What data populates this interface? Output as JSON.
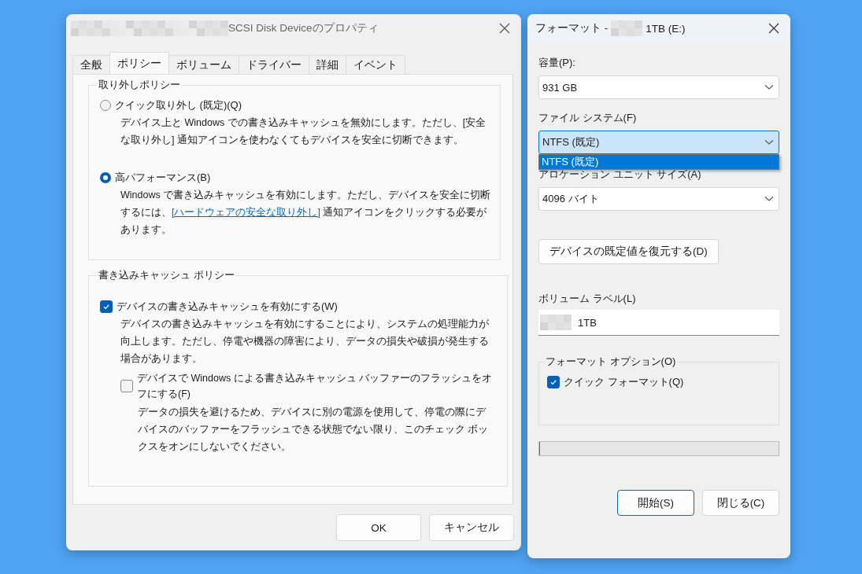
{
  "properties_window": {
    "title": "SCSI Disk Deviceのプロパティ",
    "tabs": [
      {
        "label": "全般",
        "selected": false
      },
      {
        "label": "ポリシー",
        "selected": true
      },
      {
        "label": "ボリューム",
        "selected": false
      },
      {
        "label": "ドライバー",
        "selected": false
      },
      {
        "label": "詳細",
        "selected": false
      },
      {
        "label": "イベント",
        "selected": false
      }
    ],
    "removal_policy": {
      "legend": "取り外しポリシー",
      "options": [
        {
          "label": "クイック取り外し (既定)(Q)",
          "selected": false,
          "description": "デバイス上と Windows での書き込みキャッシュを無効にします。ただし、[安全な取り外し] 通知アイコンを使わなくてもデバイスを安全に切断できます。"
        },
        {
          "label": "高パフォーマンス(B)",
          "selected": true,
          "description": "Windows で書き込みキャッシュを有効にします。ただし、デバイスを安全に切断するには、",
          "link": "[ハードウェアの安全な取り外し]",
          "description_after": " 通知アイコンをクリックする必要があります。"
        }
      ]
    },
    "write_cache_policy": {
      "legend": "書き込みキャッシュ ポリシー",
      "enable_cache": {
        "label": "デバイスの書き込みキャッシュを有効にする(W)",
        "checked": true,
        "description": "デバイスの書き込みキャッシュを有効にすることにより、システムの処理能力が向上します。ただし、停電や機器の障害により、データの損失や破損が発生する場合があります。"
      },
      "disable_flush": {
        "label": "デバイスで Windows による書き込みキャッシュ バッファーのフラッシュをオフにする(F)",
        "checked": false,
        "description": "データの損失を避けるため、デバイスに別の電源を使用して、停電の際にデバイスのバッファーをフラッシュできる状態でない限り、このチェック ボックスをオンにしないでください。"
      }
    },
    "buttons": [
      "OK",
      "キャンセル"
    ]
  },
  "format_window": {
    "title_prefix": "フォーマット -",
    "title_suffix": "1TB (E:)",
    "capacity": {
      "label": "容量(P):",
      "value": "931 GB"
    },
    "file_system": {
      "label": "ファイル システム(F)",
      "value": "NTFS (既定)",
      "expanded": true,
      "options": [
        {
          "label": "NTFS (既定)",
          "selected": true
        }
      ]
    },
    "allocation_unit": {
      "label": "アロケーション ユニット サイズ(A)",
      "value": "4096 バイト"
    },
    "restore_button": "デバイスの既定値を復元する(D)",
    "volume_label": {
      "label": "ボリューム ラベル(L)",
      "value": "1TB"
    },
    "format_options": {
      "legend": "フォーマット オプション(O)",
      "quick_format": {
        "label": "クイック フォーマット(Q)",
        "checked": true
      }
    },
    "progress": {
      "level": 0
    },
    "buttons": [
      {
        "label": "開始(S)",
        "default": true
      },
      {
        "label": "閉じる(C)",
        "default": false
      }
    ]
  }
}
